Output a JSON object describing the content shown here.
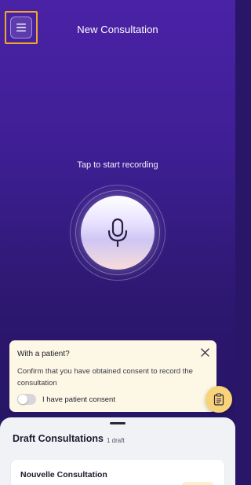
{
  "header": {
    "title": "New Consultation",
    "menu_icon": "hamburger-menu-icon"
  },
  "recorder": {
    "hint": "Tap to start recording",
    "mic_icon": "microphone-icon"
  },
  "consent_card": {
    "title": "With a patient?",
    "message": "Confirm that you have obtained consent to record the consultation",
    "toggle_label": "I have patient consent",
    "toggle_on": false,
    "close_icon": "close-icon"
  },
  "fab": {
    "icon": "clipboard-icon"
  },
  "drafts": {
    "title": "Draft Consultations",
    "count_label": "1 draft",
    "items": [
      {
        "name": "Nouvelle Consultation"
      }
    ]
  },
  "colors": {
    "background_top": "#4a22a6",
    "background_bottom": "#241460",
    "highlight_border": "#f0a827",
    "consent_card_bg": "#fdf7e6",
    "fab_bg": "#f7d479",
    "sheet_bg": "#f1f2f6"
  }
}
